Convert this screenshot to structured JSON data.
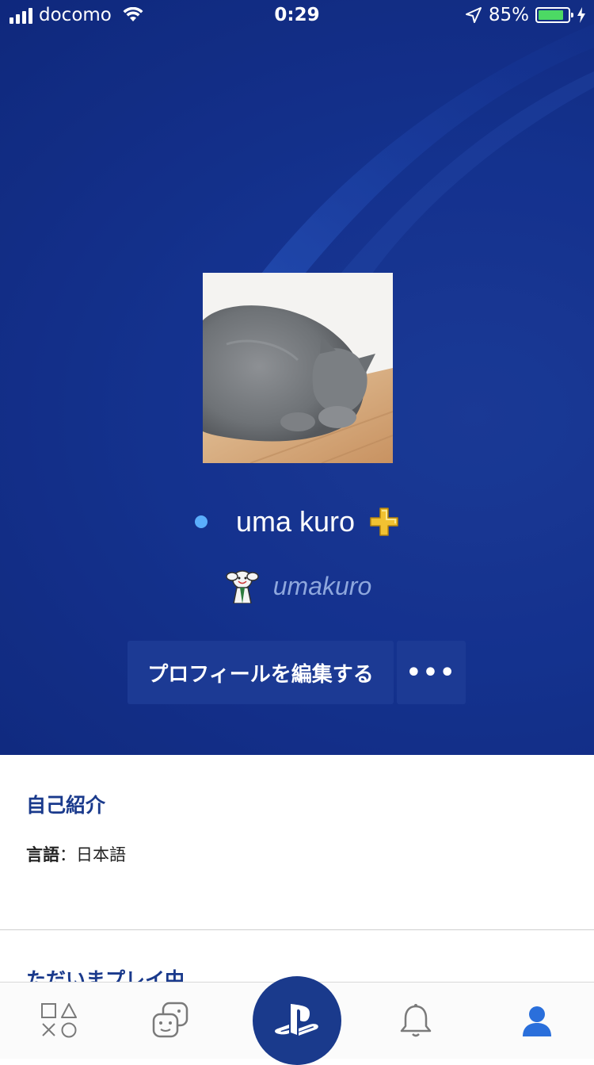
{
  "status_bar": {
    "carrier": "docomo",
    "time": "0:29",
    "battery_percent": "85%",
    "battery_level": 0.85,
    "signal_bars": 4
  },
  "profile": {
    "display_name": "uma kuro",
    "online_id": "umakuro",
    "online_status": "online",
    "ps_plus": true
  },
  "actions": {
    "edit_label": "プロフィールを編集する",
    "more_label": "•••"
  },
  "about": {
    "title": "自己紹介",
    "language_label": "言語",
    "separator": "：",
    "language_value": "日本語"
  },
  "now_playing": {
    "title": "ただいまプレイ中"
  },
  "tab_bar": {
    "tabs": [
      {
        "icon": "games-shapes-icon",
        "active": false
      },
      {
        "icon": "friends-icon",
        "active": false
      },
      {
        "icon": "playstation-logo-icon",
        "active": false
      },
      {
        "icon": "bell-icon",
        "active": false
      },
      {
        "icon": "profile-icon",
        "active": true
      }
    ]
  },
  "colors": {
    "hero_background": "#163593",
    "accent": "#1a3a8c",
    "online_dot": "#5aaefc",
    "battery_fill": "#4cd964",
    "active_tab": "#2a6fdb",
    "inactive_tab": "#7a7a7a"
  }
}
